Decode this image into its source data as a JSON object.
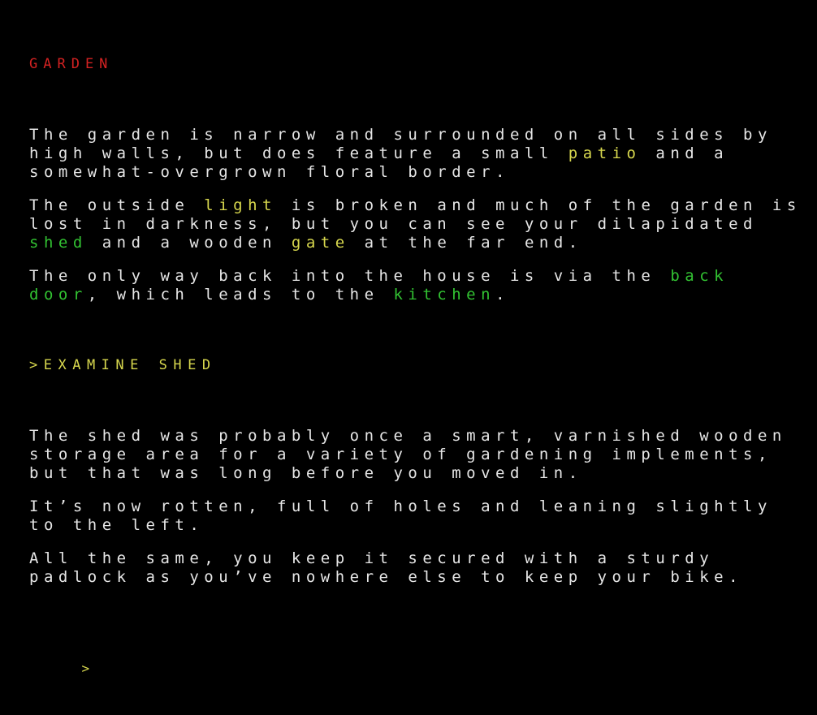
{
  "location": {
    "title": "GARDEN"
  },
  "colors": {
    "title": "#d42222",
    "text": "#e6e6e6",
    "item": "#d8d84e",
    "exit": "#32c232",
    "background": "#000000"
  },
  "room_description": [
    {
      "lines": [
        [
          {
            "t": "The garden is narrow and surrounded on all sides by"
          }
        ],
        [
          {
            "t": "high walls, but does feature a small "
          },
          {
            "t": "patio",
            "c": "y"
          },
          {
            "t": " and a"
          }
        ],
        [
          {
            "t": "somewhat-overgrown floral border."
          }
        ]
      ]
    },
    {
      "lines": [
        [
          {
            "t": "The outside "
          },
          {
            "t": "light",
            "c": "y"
          },
          {
            "t": " is broken and much of the garden is"
          }
        ],
        [
          {
            "t": "lost in darkness, but you can see your dilapidated"
          }
        ],
        [
          {
            "t": "shed",
            "c": "g"
          },
          {
            "t": " and a wooden "
          },
          {
            "t": "gate",
            "c": "y"
          },
          {
            "t": " at the far end."
          }
        ]
      ]
    },
    {
      "lines": [
        [
          {
            "t": "The only way back into the house is via the "
          },
          {
            "t": "back",
            "c": "g"
          }
        ],
        [
          {
            "t": "door",
            "c": "g"
          },
          {
            "t": ", which leads to the "
          },
          {
            "t": "kitchen",
            "c": "g"
          },
          {
            "t": "."
          }
        ]
      ]
    }
  ],
  "command": {
    "text": ">EXAMINE SHED"
  },
  "response": [
    {
      "lines": [
        [
          {
            "t": "The shed was probably once a smart, varnished wooden"
          }
        ],
        [
          {
            "t": "storage area for a variety of gardening implements,"
          }
        ],
        [
          {
            "t": "but that was long before you moved in."
          }
        ]
      ]
    },
    {
      "lines": [
        [
          {
            "t": "It’s now rotten, full of holes and leaning slightly"
          }
        ],
        [
          {
            "t": "to the left."
          }
        ]
      ]
    },
    {
      "lines": [
        [
          {
            "t": "All the same, you keep it secured with a sturdy"
          }
        ],
        [
          {
            "t": "padlock as you’ve nowhere else to keep your bike."
          }
        ]
      ]
    }
  ],
  "input": {
    "prompt": ">",
    "value": ""
  }
}
